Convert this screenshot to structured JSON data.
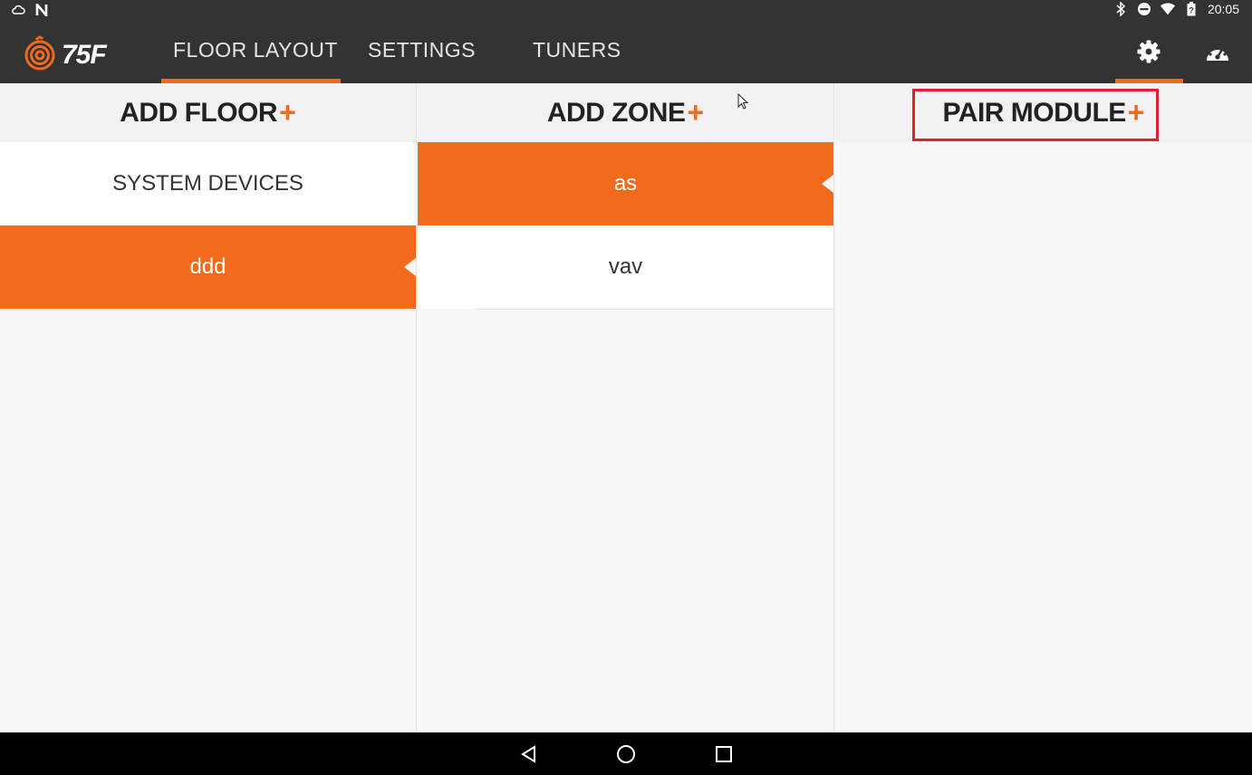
{
  "status_bar": {
    "time": "20:05",
    "left_icons": [
      "cloud-icon",
      "notification-n-icon"
    ],
    "right_icons": [
      "bluetooth-icon",
      "do-not-disturb-icon",
      "wifi-icon",
      "battery-icon"
    ]
  },
  "app_bar": {
    "logo_text": "75F",
    "tabs": [
      {
        "label": "FLOOR LAYOUT",
        "selected": true
      },
      {
        "label": "SETTINGS",
        "selected": false
      },
      {
        "label": "TUNERS",
        "selected": false
      }
    ],
    "actions": [
      "settings-gear-icon",
      "dashboard-gauge-icon"
    ],
    "accent_color": "#f26a1b"
  },
  "floors": {
    "header": "ADD FLOOR",
    "plus": "+",
    "items": [
      {
        "label": "SYSTEM DEVICES",
        "selected": false
      },
      {
        "label": "ddd",
        "selected": true
      }
    ]
  },
  "zones": {
    "header": "ADD ZONE",
    "plus": "+",
    "items": [
      {
        "label": "as",
        "selected": true
      },
      {
        "label": "vav",
        "selected": false
      }
    ]
  },
  "modules": {
    "header": "PAIR MODULE",
    "plus": "+",
    "highlight_color": "#e0202f"
  },
  "nav_bar": {
    "buttons": [
      "back-icon",
      "home-icon",
      "recents-icon"
    ]
  }
}
